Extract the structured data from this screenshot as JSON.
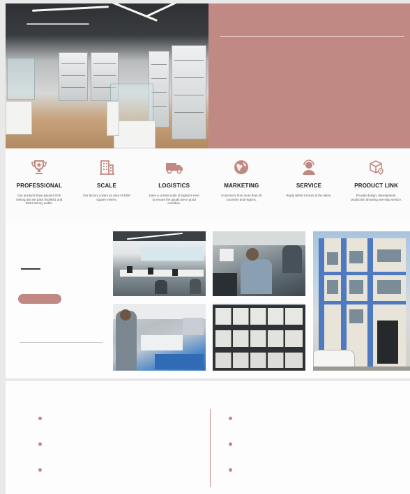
{
  "brand": {
    "accent_color": "#c08983",
    "dark_text": "#222222"
  },
  "hero": {
    "photo_icon": "showroom-photo"
  },
  "features": [
    {
      "icon": "trophy-icon",
      "title": "PROFESSIONAL",
      "desc": "Our products have passed SGS testing,and we pass ISO9001 and BSCI factory audits."
    },
    {
      "icon": "building-icon",
      "title": "SCALE",
      "desc": "Our factory covers an area of 4000 square meters."
    },
    {
      "icon": "truck-icon",
      "title": "LOGISTICS",
      "desc": "Have a certain scale of logistics level to ensure the goods are in good condition."
    },
    {
      "icon": "globe-icon",
      "title": "MARKETING",
      "desc": "Customers from more than 30 countries and regions."
    },
    {
      "icon": "headset-icon",
      "title": "SERVICE",
      "desc": "Reply within 8 hours at the latest."
    },
    {
      "icon": "box-link-icon",
      "title": "PRODUCT LINK",
      "desc": "Provide design, development, production,shooting one-stop service."
    }
  ],
  "gallery": {
    "photos": [
      "office-photo",
      "workers-photo",
      "packing-photo",
      "warehouse-shelves-photo",
      "factory-building-photo"
    ]
  }
}
